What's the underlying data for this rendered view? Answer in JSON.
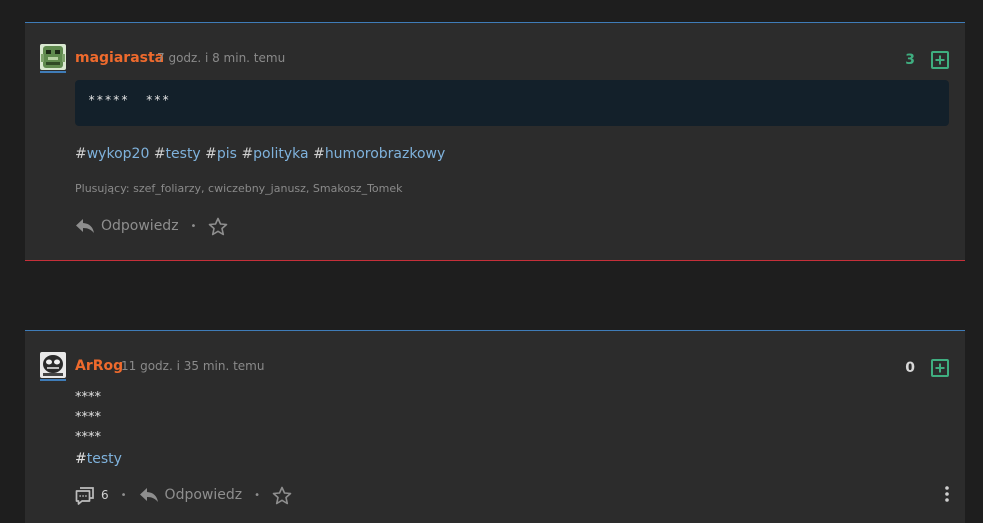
{
  "accent_blue": "#3f7cb8",
  "accent_red": "#c6303a",
  "username_color": "#ee6a2d",
  "tag_color": "#7fb2dc",
  "plus_green": "#3fae80",
  "posts": [
    {
      "username": "magiarasta",
      "time": "7 godz. i 8 min. temu",
      "votes": "3",
      "code": "*****  ***",
      "tags_prefix": "#",
      "tags": [
        "wykop20",
        "testy",
        "pis",
        "polityka",
        "humorobrazkowy"
      ],
      "plusers_label": "Plusujący:",
      "plusers": "szef_foliarzy, cwiczebny_janusz, Smakosz_Tomek",
      "reply_label": "Odpowiedz",
      "dot": "•",
      "icons": [
        "reply-icon",
        "star-icon",
        "plus-square-icon"
      ]
    },
    {
      "username": "ArRog",
      "time": "11 godz. i 35 min. temu",
      "votes": "0",
      "lines": [
        "****",
        "****",
        "****"
      ],
      "tag": "testy",
      "comments_count": "6",
      "reply_label": "Odpowiedz",
      "dot": "•",
      "icons": [
        "comments-icon",
        "reply-icon",
        "star-icon",
        "plus-square-icon",
        "more-vertical-icon"
      ]
    }
  ]
}
